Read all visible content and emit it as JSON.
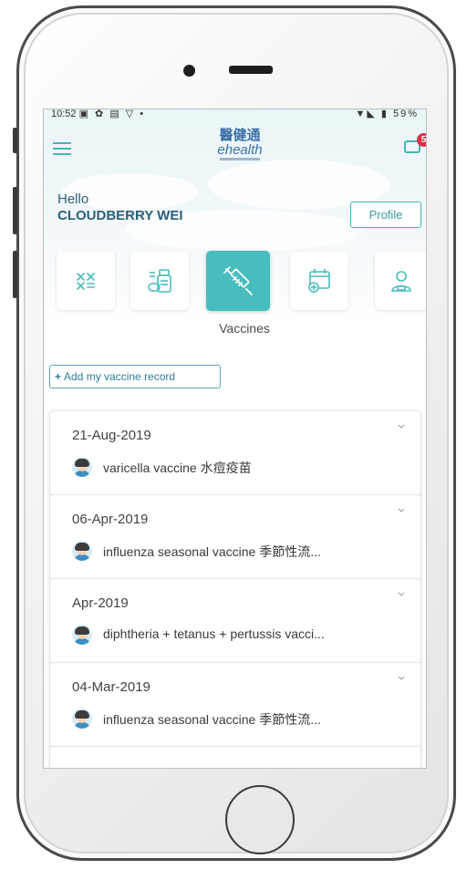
{
  "status_bar": {
    "time": "10:52",
    "left_icons": "▣ ✿ ▤ ▽ •",
    "right_icons": "▼◣ ▮ 59%"
  },
  "header": {
    "logo_cn": "醫健通",
    "logo_en": "ehealth",
    "notification_count": "5"
  },
  "greeting": {
    "hello": "Hello",
    "name": "CLOUDBERRY WEI"
  },
  "profile_button": "Profile",
  "categories": {
    "items": [
      {
        "icon": "allergy-icon",
        "label": ""
      },
      {
        "icon": "medication-icon",
        "label": ""
      },
      {
        "icon": "syringe-icon",
        "label": "Vaccines",
        "active": true
      },
      {
        "icon": "appointment-icon",
        "label": ""
      },
      {
        "icon": "doctor-icon",
        "label": ""
      }
    ],
    "selected_label": "Vaccines"
  },
  "add_record_button": {
    "plus": "+",
    "label": "Add my vaccine record"
  },
  "records": [
    {
      "date": "21-Aug-2019",
      "name": "varicella vaccine 水痘疫苗"
    },
    {
      "date": "06-Apr-2019",
      "name": "influenza seasonal vaccine 季節性流..."
    },
    {
      "date": "Apr-2019",
      "name": "diphtheria + tetanus + pertussis vacci..."
    },
    {
      "date": "04-Mar-2019",
      "name": "influenza seasonal vaccine 季節性流..."
    }
  ],
  "colors": {
    "accent": "#48bdbd",
    "brand_blue": "#3a6fa8",
    "badge": "#e02d4a",
    "text_primary": "#2c5f7a"
  }
}
